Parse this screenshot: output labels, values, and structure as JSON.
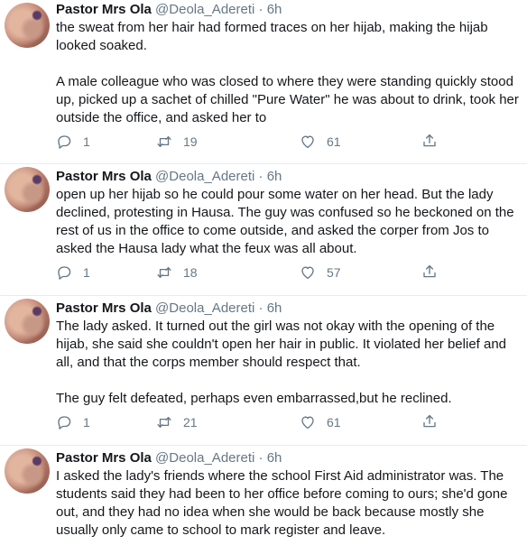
{
  "tweets": [
    {
      "name": "Pastor Mrs Ola",
      "handle": "@Deola_Adereti",
      "dot": "·",
      "time": "6h",
      "paragraphs": [
        "the sweat from her hair had formed traces on her hijab, making the hijab looked soaked.",
        "A male colleague who was closed to where they were standing quickly stood up, picked up a sachet of chilled \"Pure Water\" he was about to drink, took her outside the office, and asked her to"
      ],
      "replies": "1",
      "retweets": "19",
      "likes": "61"
    },
    {
      "name": "Pastor Mrs Ola",
      "handle": "@Deola_Adereti",
      "dot": "·",
      "time": "6h",
      "paragraphs": [
        "open up her hijab so he could pour some water on her head. But the lady declined, protesting in Hausa. The guy was confused so he beckoned on the rest of us in the office to come outside, and asked the corper from Jos to asked the Hausa lady what the feux was all about."
      ],
      "replies": "1",
      "retweets": "18",
      "likes": "57"
    },
    {
      "name": "Pastor Mrs Ola",
      "handle": "@Deola_Adereti",
      "dot": "·",
      "time": "6h",
      "paragraphs": [
        "The lady asked. It turned out the girl was not okay with the opening of the hijab, she said she couldn't open her hair in public. It violated her belief and all, and that the corps member should respect that.",
        "The guy felt defeated, perhaps even embarrassed,but he reclined."
      ],
      "replies": "1",
      "retweets": "21",
      "likes": "61"
    },
    {
      "name": "Pastor Mrs Ola",
      "handle": "@Deola_Adereti",
      "dot": "·",
      "time": "6h",
      "paragraphs": [
        "I asked the lady's friends where the school First Aid administrator was. The students said they had been to her office before coming to ours; she'd gone out, and they had no idea when she would be back because mostly she usually only came to school to mark register and leave."
      ]
    }
  ],
  "icons": {
    "reply": "reply-icon",
    "retweet": "retweet-icon",
    "like": "like-icon",
    "share": "share-icon"
  },
  "colors": {
    "text": "#14171a",
    "muted": "#657786",
    "divider": "#e6ecf0"
  }
}
